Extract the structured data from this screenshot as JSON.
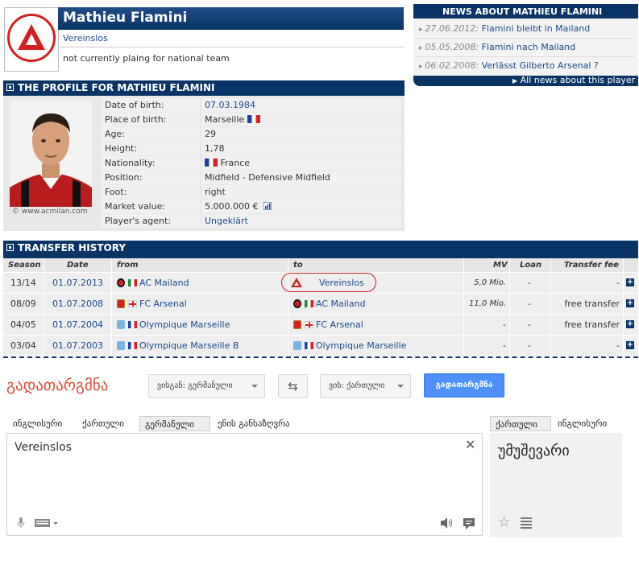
{
  "player": {
    "name": "Mathieu Flamini",
    "club": "Vereinslos",
    "national_status": "not currently plaing for national team"
  },
  "news": {
    "title": "NEWS ABOUT MATHIEU FLAMINI",
    "items": [
      {
        "date": "27.06.2012:",
        "text": "Flamini bleibt in Mailand"
      },
      {
        "date": "05.05.2008:",
        "text": "Flamini nach Mailand"
      },
      {
        "date": "06.02.2008:",
        "text": "Verlässt Gilberto Arsenal ?"
      }
    ],
    "all_link": "All news about this player"
  },
  "profile": {
    "title": "THE PROFILE FOR MATHIEU FLAMINI",
    "photo_credit": "© www.acmilan.com",
    "rows": [
      {
        "label": "Date of birth:",
        "value": "07.03.1984"
      },
      {
        "label": "Place of birth:",
        "value": "Marseille"
      },
      {
        "label": "Age:",
        "value": "29"
      },
      {
        "label": "Height:",
        "value": "1,78"
      },
      {
        "label": "Nationality:",
        "value": "France"
      },
      {
        "label": "Position:",
        "value": "Midfield - Defensive Midfield"
      },
      {
        "label": "Foot:",
        "value": "right"
      },
      {
        "label": "Market value:",
        "value": "5.000.000 €"
      },
      {
        "label": "Player's agent:",
        "value": "Ungeklärt"
      }
    ]
  },
  "transfers": {
    "title": "TRANSFER HISTORY",
    "headers": {
      "season": "Season",
      "date": "Date",
      "from": "from",
      "to": "to",
      "mv": "MV",
      "loan": "Loan",
      "fee": "Transfer fee"
    },
    "rows": [
      {
        "season": "13/14",
        "date": "01.07.2013",
        "from": "AC Mailand",
        "to": "Vereinslos",
        "mv": "5,0 Mio.",
        "loan": "-",
        "fee": "-"
      },
      {
        "season": "08/09",
        "date": "01.07.2008",
        "from": "FC Arsenal",
        "to": "AC Mailand",
        "mv": "11,0 Mio.",
        "loan": "-",
        "fee": "free transfer"
      },
      {
        "season": "04/05",
        "date": "01.07.2004",
        "from": "Olympique Marseille",
        "to": "FC Arsenal",
        "mv": "-",
        "loan": "-",
        "fee": "free transfer"
      },
      {
        "season": "03/04",
        "date": "01.07.2003",
        "from": "Olympique Marseille B",
        "to": "Olympique Marseille",
        "mv": "-",
        "loan": "-",
        "fee": "-"
      }
    ]
  },
  "translate": {
    "title": "გადათარგმნა",
    "from_select": "ვისგან: გერმანული",
    "to_select": "ვის: ქართული",
    "translate_button": "გადათარგმნა",
    "source_tabs": [
      "ინგლისური",
      "ქართული",
      "გერმანული",
      "ენის განსაზღვრა"
    ],
    "target_tabs": [
      "ქართული",
      "ინგლისური"
    ],
    "source_text": "Vereinslos",
    "result_text": "უმუშევარი",
    "colors": {
      "title": "#dd4b39",
      "primary_button": "#4d90fe"
    }
  },
  "colors": {
    "header_navy": "#0a3466",
    "accent_red": "#d42020"
  }
}
